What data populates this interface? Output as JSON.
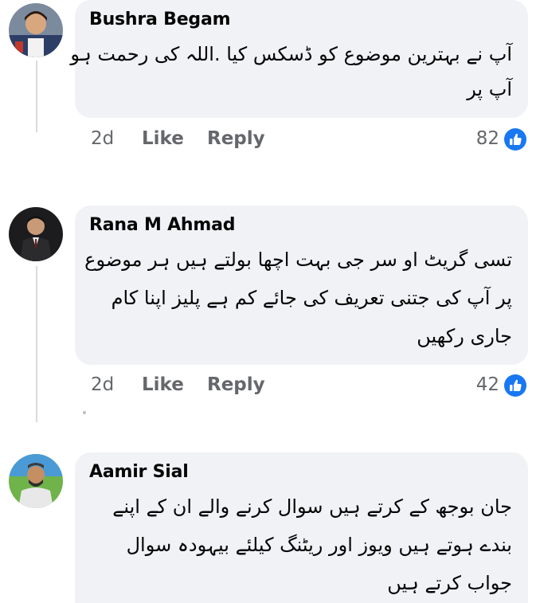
{
  "comments": [
    {
      "author": "Bushra Begam",
      "lines": [
        "آپ نے بہترین موضوع کو ڈسکس کیا .اللہ کی رحمت ہو",
        "آپ پر"
      ],
      "time": "2d",
      "like_label": "Like",
      "reply_label": "Reply",
      "reactions": "82",
      "avatar_icon": "profile-photo-child"
    },
    {
      "author": "Rana M Ahmad",
      "lines": [
        "تسی گریٹ او سر جی بہت اچھا بولتے ہیں ہر موضوع",
        "پر آپ کی جتنی تعریف کی جائے کم ہے پلیز اپنا کام",
        "جاری رکھیں"
      ],
      "time": "2d",
      "like_label": "Like",
      "reply_label": "Reply",
      "reactions": "42",
      "avatar_icon": "profile-photo-man-suit"
    },
    {
      "author": "Aamir Sial",
      "lines": [
        "جان بوجھ کے کرتے ہیں سوال کرنے والے ان کے اپنے",
        "بندے ہوتے ہیں ویوز اور ریٹنگ کیلئے بیہودہ سوال",
        "جواب کرتے ہیں"
      ],
      "avatar_icon": "profile-photo-man-outdoor"
    }
  ],
  "colors": {
    "bubble": "#f0f2f5",
    "meta_text": "#65676b",
    "like_blue": "#1877f2"
  }
}
